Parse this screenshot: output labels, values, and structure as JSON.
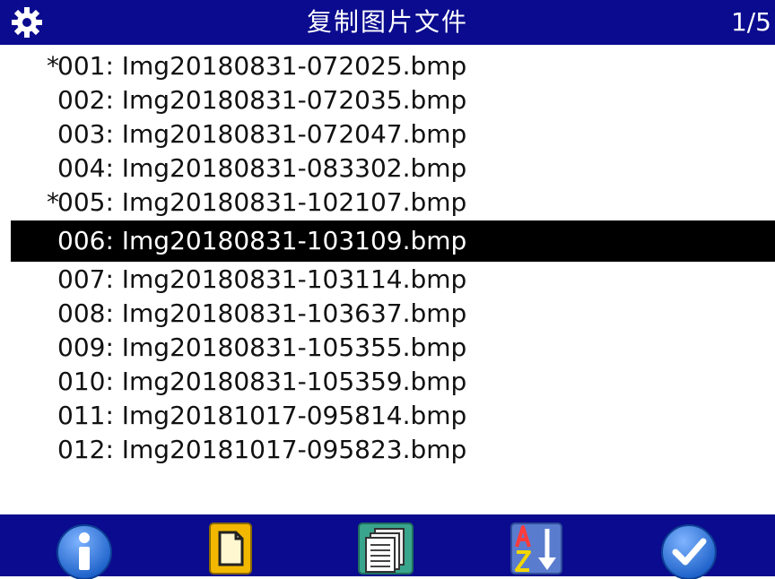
{
  "title_bar": {
    "icon": "gear-icon",
    "title": "复制图片文件",
    "page_indicator": "1/5"
  },
  "file_list": {
    "items": [
      {
        "mark": "*",
        "label": "001: Img20180831-072025.bmp"
      },
      {
        "mark": "",
        "label": "002: Img20180831-072035.bmp"
      },
      {
        "mark": "",
        "label": "003: Img20180831-072047.bmp"
      },
      {
        "mark": "",
        "label": "004: Img20180831-083302.bmp"
      },
      {
        "mark": "*",
        "label": "005: Img20180831-102107.bmp"
      },
      {
        "mark": "",
        "label": "006: Img20180831-103109.bmp",
        "selected": true
      },
      {
        "mark": "",
        "label": "007: Img20180831-103114.bmp"
      },
      {
        "mark": "",
        "label": "008: Img20180831-103637.bmp"
      },
      {
        "mark": "",
        "label": "009: Img20180831-105355.bmp"
      },
      {
        "mark": "",
        "label": "010: Img20180831-105359.bmp"
      },
      {
        "mark": "",
        "label": "011: Img20181017-095814.bmp"
      },
      {
        "mark": "",
        "label": "012: Img20181017-095823.bmp"
      }
    ]
  },
  "toolbar": {
    "buttons": [
      "info-icon",
      "single-file-icon",
      "multiple-files-icon",
      "sort-az-icon",
      "confirm-check-icon"
    ]
  },
  "colors": {
    "bar_blue": "#0a0b8e",
    "selected_bg": "#000000",
    "icon_blue": "#2b73d6",
    "icon_gold": "#f2b800"
  }
}
